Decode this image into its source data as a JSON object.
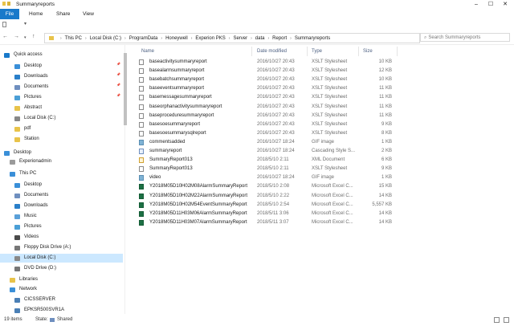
{
  "window": {
    "title": "Summaryreports"
  },
  "ribbon": {
    "file": "File",
    "home": "Home",
    "share": "Share",
    "view": "View"
  },
  "address": {
    "crumbs": [
      "This PC",
      "Local Disk (C:)",
      "ProgramData",
      "Honeywell",
      "Experion PKS",
      "Server",
      "data",
      "Report",
      "Summaryreports"
    ],
    "search_placeholder": "Search Summaryreports"
  },
  "nav": [
    {
      "label": "Quick access",
      "icon": "star-icon",
      "color": "#1979ca"
    },
    {
      "label": "Desktop",
      "icon": "desktop-icon",
      "color": "#3a8fd8"
    },
    {
      "label": "Downloads",
      "icon": "download-icon",
      "color": "#2a7fc9"
    },
    {
      "label": "Documents",
      "icon": "documents-icon",
      "color": "#6f8fbf"
    },
    {
      "label": "Pictures",
      "icon": "pictures-icon",
      "color": "#4b9fd6"
    },
    {
      "label": "Abstract",
      "icon": "folder-icon",
      "color": "#e8c34a"
    },
    {
      "label": "Local Disk (C:)",
      "icon": "disk-icon",
      "color": "#888888"
    },
    {
      "label": "pdf",
      "icon": "folder-icon",
      "color": "#e8c34a"
    },
    {
      "label": "Station",
      "icon": "folder-icon",
      "color": "#e8c34a"
    },
    {
      "label": "Desktop",
      "icon": "desktop-icon",
      "color": "#3a8fd8"
    },
    {
      "label": "Experionadmin",
      "icon": "user-icon",
      "color": "#9a9a9a"
    },
    {
      "label": "This PC",
      "icon": "computer-icon",
      "color": "#3a8fd8"
    },
    {
      "label": "Desktop",
      "icon": "desktop-icon",
      "color": "#3a8fd8"
    },
    {
      "label": "Documents",
      "icon": "documents-icon",
      "color": "#6f8fbf"
    },
    {
      "label": "Downloads",
      "icon": "download-icon",
      "color": "#2a7fc9"
    },
    {
      "label": "Music",
      "icon": "music-icon",
      "color": "#5aa0d8"
    },
    {
      "label": "Pictures",
      "icon": "pictures-icon",
      "color": "#4b9fd6"
    },
    {
      "label": "Videos",
      "icon": "video-icon",
      "color": "#4a4a4a"
    },
    {
      "label": "Floppy Disk Drive (A:)",
      "icon": "floppy-icon",
      "color": "#777777"
    },
    {
      "label": "Local Disk (C:)",
      "icon": "disk-icon",
      "color": "#888888"
    },
    {
      "label": "DVD Drive (D:)",
      "icon": "dvd-icon",
      "color": "#777777"
    },
    {
      "label": "Libraries",
      "icon": "libraries-icon",
      "color": "#e8c34a"
    },
    {
      "label": "Network",
      "icon": "network-icon",
      "color": "#3a8fd8"
    },
    {
      "label": "CICSSERVER",
      "icon": "server-icon",
      "color": "#4a7fb5"
    },
    {
      "label": "EPKSR500SVR1A",
      "icon": "server-icon",
      "color": "#4a7fb5"
    }
  ],
  "columns": {
    "name": "Name",
    "date": "Date modified",
    "type": "Type",
    "size": "Size"
  },
  "files": [
    {
      "name": "baseactivitysummaryreport",
      "date": "2016/10/27 20:43",
      "type": "XSLT Stylesheet",
      "size": "10 KB",
      "kind": "xslt"
    },
    {
      "name": "basealarmsummaryreport",
      "date": "2016/10/27 20:43",
      "type": "XSLT Stylesheet",
      "size": "12 KB",
      "kind": "xslt"
    },
    {
      "name": "basebatchsummaryreport",
      "date": "2016/10/27 20:43",
      "type": "XSLT Stylesheet",
      "size": "10 KB",
      "kind": "xslt"
    },
    {
      "name": "baseeventsummaryreport",
      "date": "2016/10/27 20:43",
      "type": "XSLT Stylesheet",
      "size": "11 KB",
      "kind": "xslt"
    },
    {
      "name": "basemessagesummaryreport",
      "date": "2016/10/27 20:43",
      "type": "XSLT Stylesheet",
      "size": "11 KB",
      "kind": "xslt"
    },
    {
      "name": "baseorphanactivitysummaryreport",
      "date": "2016/10/27 20:43",
      "type": "XSLT Stylesheet",
      "size": "11 KB",
      "kind": "xslt"
    },
    {
      "name": "baseproceduresummaryreport",
      "date": "2016/10/27 20:43",
      "type": "XSLT Stylesheet",
      "size": "11 KB",
      "kind": "xslt"
    },
    {
      "name": "basesoesummaryreport",
      "date": "2016/10/27 20:43",
      "type": "XSLT Stylesheet",
      "size": "9 KB",
      "kind": "xslt"
    },
    {
      "name": "basesoesummarysqlreport",
      "date": "2016/10/27 20:43",
      "type": "XSLT Stylesheet",
      "size": "8 KB",
      "kind": "xslt"
    },
    {
      "name": "commentsadded",
      "date": "2016/10/27 18:24",
      "type": "GIF image",
      "size": "1 KB",
      "kind": "gif"
    },
    {
      "name": "summaryreport",
      "date": "2016/10/27 18:24",
      "type": "Cascading Style S...",
      "size": "2 KB",
      "kind": "css"
    },
    {
      "name": "SummaryReport013",
      "date": "2018/5/10 2:11",
      "type": "XML Document",
      "size": "6 KB",
      "kind": "xml"
    },
    {
      "name": "SummaryReport013",
      "date": "2018/5/10 2:11",
      "type": "XSLT Stylesheet",
      "size": "9 KB",
      "kind": "xslt"
    },
    {
      "name": "video",
      "date": "2016/10/27 18:24",
      "type": "GIF image",
      "size": "1 KB",
      "kind": "gif"
    },
    {
      "name": "Y2018M05D10H02M08AlarmSummaryReport",
      "date": "2018/5/10 2:08",
      "type": "Microsoft Excel C...",
      "size": "15 KB",
      "kind": "xls"
    },
    {
      "name": "Y2018M05D10H02M22AlarmSummaryReport",
      "date": "2018/5/10 2:22",
      "type": "Microsoft Excel C...",
      "size": "14 KB",
      "kind": "xls"
    },
    {
      "name": "Y2018M05D10H02M54EventSummaryReport",
      "date": "2018/5/10 2:54",
      "type": "Microsoft Excel C...",
      "size": "5,557 KB",
      "kind": "xls"
    },
    {
      "name": "Y2018M05D11H03M06AlarmSummaryReport",
      "date": "2018/5/11 3:06",
      "type": "Microsoft Excel C...",
      "size": "14 KB",
      "kind": "xls"
    },
    {
      "name": "Y2018M05D11H03M07AlarmSummaryReport",
      "date": "2018/5/11 3:07",
      "type": "Microsoft Excel C...",
      "size": "14 KB",
      "kind": "xls"
    }
  ],
  "status": {
    "count": "19 items",
    "state_label": "State:",
    "state_value": "Shared"
  }
}
